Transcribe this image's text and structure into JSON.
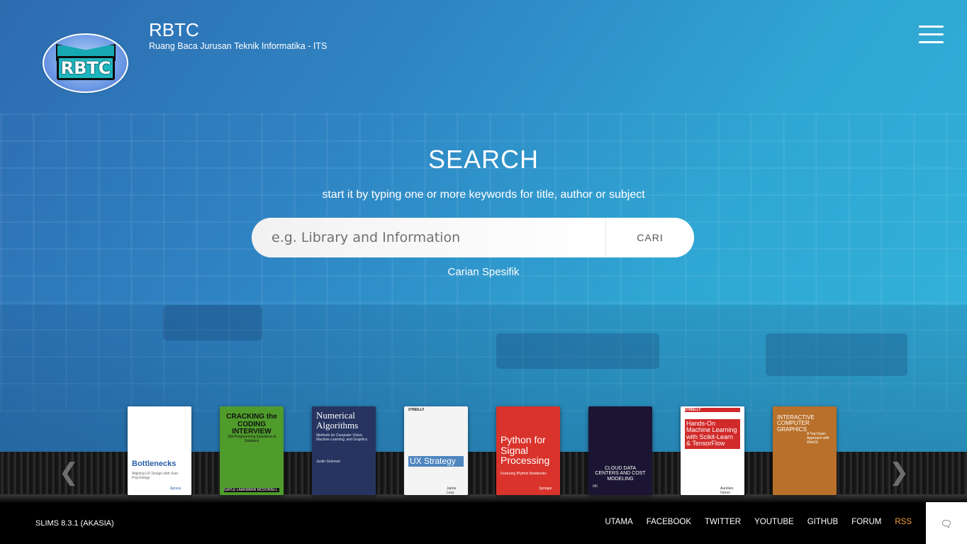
{
  "header": {
    "title": "RBTC",
    "subtitle": "Ruang Baca Jurusan Teknik Informatika - ITS",
    "logo_text": "RBTC"
  },
  "search": {
    "title": "SEARCH",
    "hint": "start it by typing one or more keywords for title, author or subject",
    "placeholder": "e.g. Library and Information",
    "button_label": "CARI",
    "advanced_link": "Carian Spesifik"
  },
  "carousel": {
    "books": [
      {
        "title": "Bottlenecks",
        "subtitle": "Aligning UX Design with User Psychology",
        "publisher": "Apress",
        "bg": "#ffffff",
        "fg": "#2a5fa8"
      },
      {
        "title": "CRACKING the CODING INTERVIEW",
        "subtitle": "189 Programming Questions & Solutions",
        "publisher": "GAYLE LAAKMANN MCDOWELL",
        "bg": "#4f9b2c",
        "fg": "#111111"
      },
      {
        "title": "Numerical Algorithms",
        "subtitle": "Methods for Computer Vision, Machine Learning, and Graphics",
        "publisher": "Justin Solomon",
        "bg": "#27345f",
        "fg": "#ffffff"
      },
      {
        "title": "UX Strategy",
        "subtitle": "O'REILLY",
        "publisher": "Jaime Levy",
        "bg": "#f4f4f4",
        "fg": "#2a6fb4"
      },
      {
        "title": "Python for Signal Processing",
        "subtitle": "Featuring IPython Notebooks",
        "publisher": "Springer",
        "bg": "#d9332b",
        "fg": "#ffffff"
      },
      {
        "title": "CLOUD DATA CENTERS AND COST MODELING",
        "subtitle": "",
        "publisher": "MK",
        "bg": "#1b1533",
        "fg": "#ffffff"
      },
      {
        "title": "Hands-On Machine Learning with Scikit-Learn & TensorFlow",
        "subtitle": "O'REILLY",
        "publisher": "Aurélien Géron",
        "bg": "#ffffff",
        "fg": "#d12a2a"
      },
      {
        "title": "INTERACTIVE COMPUTER GRAPHICS",
        "subtitle": "A Top-Down Approach with WebGL",
        "publisher": "",
        "bg": "#b8702a",
        "fg": "#ffffff"
      }
    ]
  },
  "footer": {
    "version": "SLIMS 8.3.1 (AKASIA)",
    "nav": [
      "UTAMA",
      "FACEBOOK",
      "TWITTER",
      "YOUTUBE",
      "GITHUB",
      "FORUM",
      "RSS"
    ]
  },
  "colors": {
    "accent": "#33b5dc",
    "rss": "#f2a23a"
  }
}
